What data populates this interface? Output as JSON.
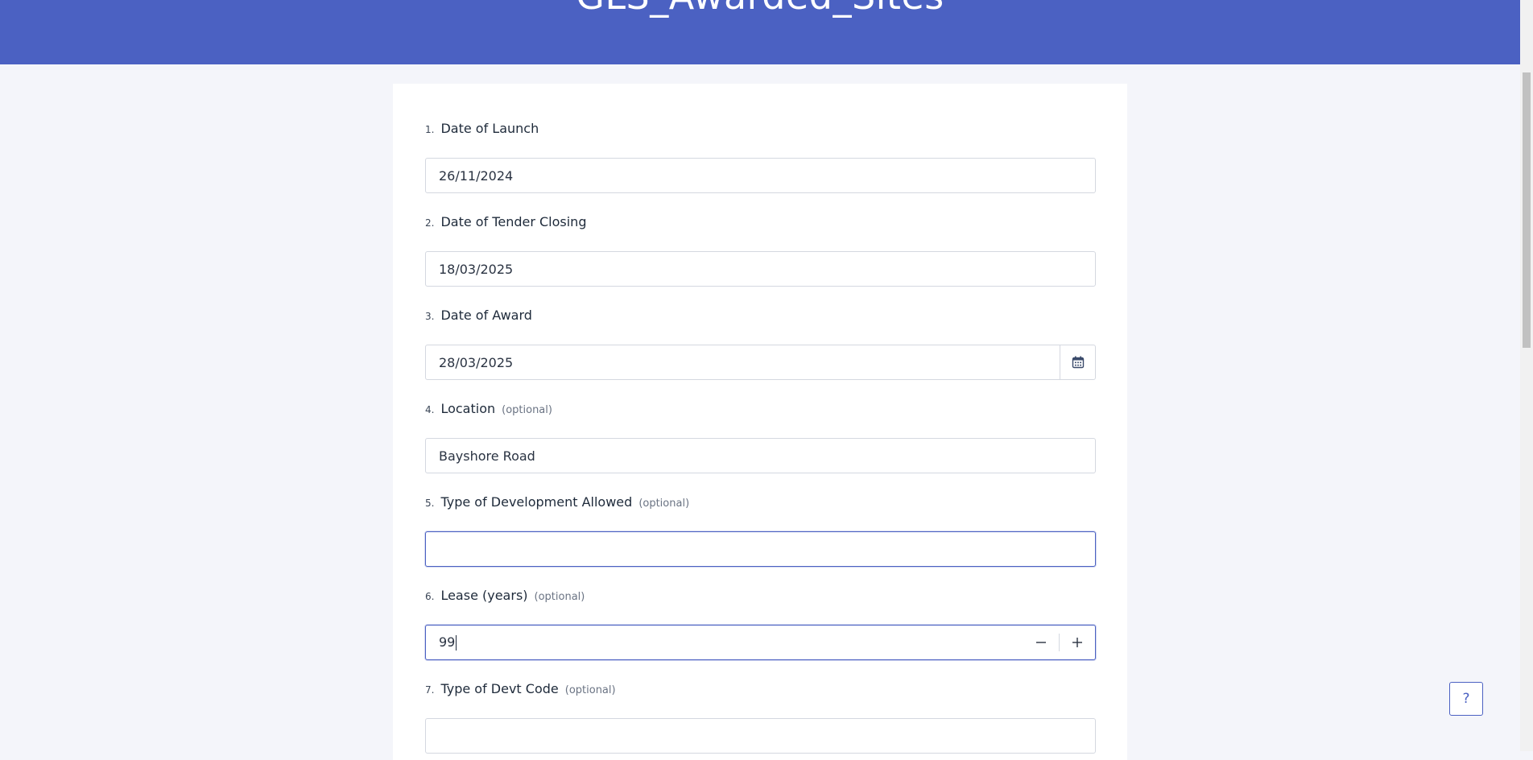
{
  "header": {
    "title": "GLS_Awarded_Sites"
  },
  "form": {
    "questions": [
      {
        "number": "1.",
        "label": "Date of Launch",
        "optional": "",
        "value": "26/11/2024"
      },
      {
        "number": "2.",
        "label": "Date of Tender Closing",
        "optional": "",
        "value": "18/03/2025"
      },
      {
        "number": "3.",
        "label": "Date of Award",
        "optional": "",
        "value": "28/03/2025",
        "icon": "calendar-icon"
      },
      {
        "number": "4.",
        "label": "Location",
        "optional": "(optional)",
        "value": "Bayshore Road"
      },
      {
        "number": "5.",
        "label": "Type of Development Allowed",
        "optional": "(optional)",
        "value": ""
      },
      {
        "number": "6.",
        "label": "Lease (years)",
        "optional": "(optional)",
        "value": "99",
        "icons": [
          "minus-icon",
          "plus-icon"
        ]
      },
      {
        "number": "7.",
        "label": "Type of Devt Code",
        "optional": "(optional)",
        "value": ""
      }
    ]
  },
  "help": {
    "label": "?"
  },
  "colors": {
    "brand": "#4b61c2",
    "background": "#f4f5fa",
    "border": "#d4d8e0"
  }
}
